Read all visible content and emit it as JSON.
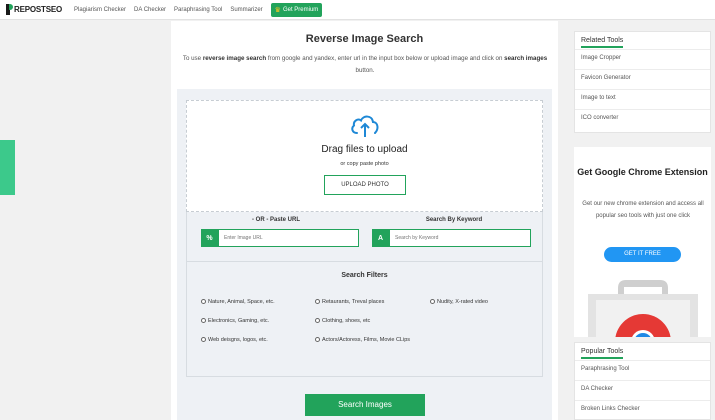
{
  "nav": {
    "logo": "REPOSTSEO",
    "items": [
      "Plagiarism Checker",
      "DA Checker",
      "Paraphrasing Tool",
      "Summarizer"
    ],
    "premium": "Get Premium"
  },
  "main": {
    "title": "Reverse Image Search",
    "desc_1": "To use ",
    "desc_bold_1": "reverse image search",
    "desc_2": " from google and yandex, enter url in the input box below or upload image and click on ",
    "desc_bold_2": "search images",
    "desc_3": " button."
  },
  "upload": {
    "drag_text": "Drag files to upload",
    "copy_text": "or copy paste photo",
    "button": "UPLOAD PHOTO"
  },
  "paste_url": {
    "label": "- OR - Paste URL",
    "placeholder": "Enter Image URL"
  },
  "keyword": {
    "label": "Search By Keyword",
    "placeholder": "Search by Keyword"
  },
  "filters": {
    "title": "Search Filters",
    "options": [
      "Nature, Animal, Space, etc.",
      "Retaurants, Treval places",
      "Nudity, X-rated video",
      "Electronics, Gaming, etc.",
      "Clothing, shoes, etc",
      "Web deisgns, logos, etc.",
      "Actors/Actoress, Films, Movie CLips"
    ]
  },
  "search_button": "Search Images",
  "related": {
    "title": "Related Tools",
    "items": [
      "Image Cropper",
      "Favicon Generator",
      "Image to text",
      "ICO converter"
    ]
  },
  "chrome": {
    "title": "Get Google Chrome Extension",
    "desc": "Get our new chrome extension and access all popular seo tools with just one click",
    "button": "GET IT FREE"
  },
  "popular": {
    "title": "Popular Tools",
    "items": [
      "Paraphrasing Tool",
      "DA Checker",
      "Broken Links Checker"
    ]
  },
  "colors": {
    "accent": "#22a35b",
    "blue": "#2196f3"
  }
}
